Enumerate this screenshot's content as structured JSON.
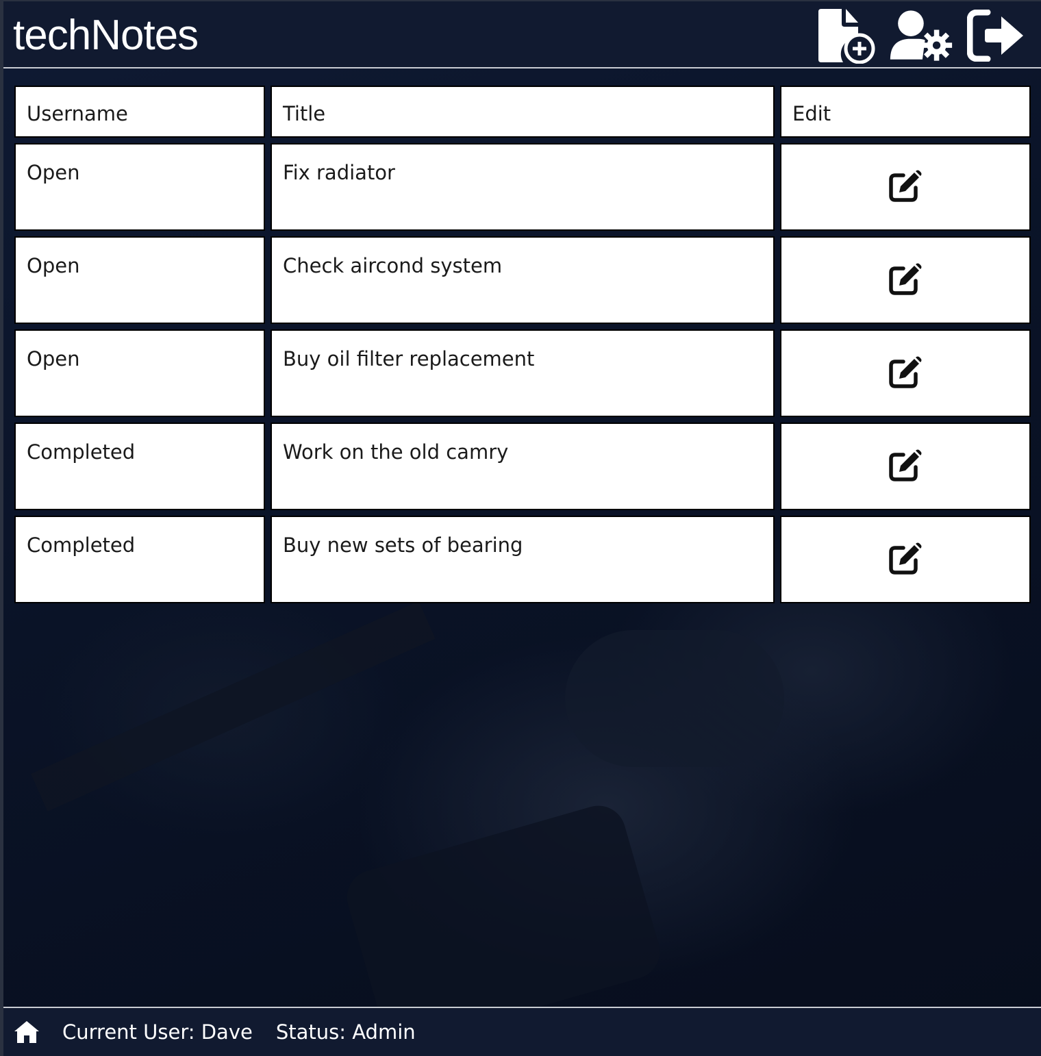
{
  "app": {
    "title": "techNotes"
  },
  "header": {
    "icons": [
      "new-note-icon",
      "user-settings-icon",
      "logout-icon"
    ]
  },
  "table": {
    "headers": [
      "Username",
      "Title",
      "Edit"
    ],
    "rows": [
      {
        "status": "Open",
        "status_type": "open",
        "title": "Fix radiator"
      },
      {
        "status": "Open",
        "status_type": "open",
        "title": "Check aircond system"
      },
      {
        "status": "Open",
        "status_type": "open",
        "title": "Buy oil filter replacement"
      },
      {
        "status": "Completed",
        "status_type": "completed",
        "title": "Work on the old camry"
      },
      {
        "status": "Completed",
        "status_type": "completed",
        "title": "Buy new sets of bearing"
      }
    ]
  },
  "footer": {
    "current_user": "Current User: Dave",
    "status": "Status: Admin"
  },
  "colors": {
    "open": "#a8322a",
    "completed": "#6cc04a",
    "header_bg": "#111a30"
  }
}
